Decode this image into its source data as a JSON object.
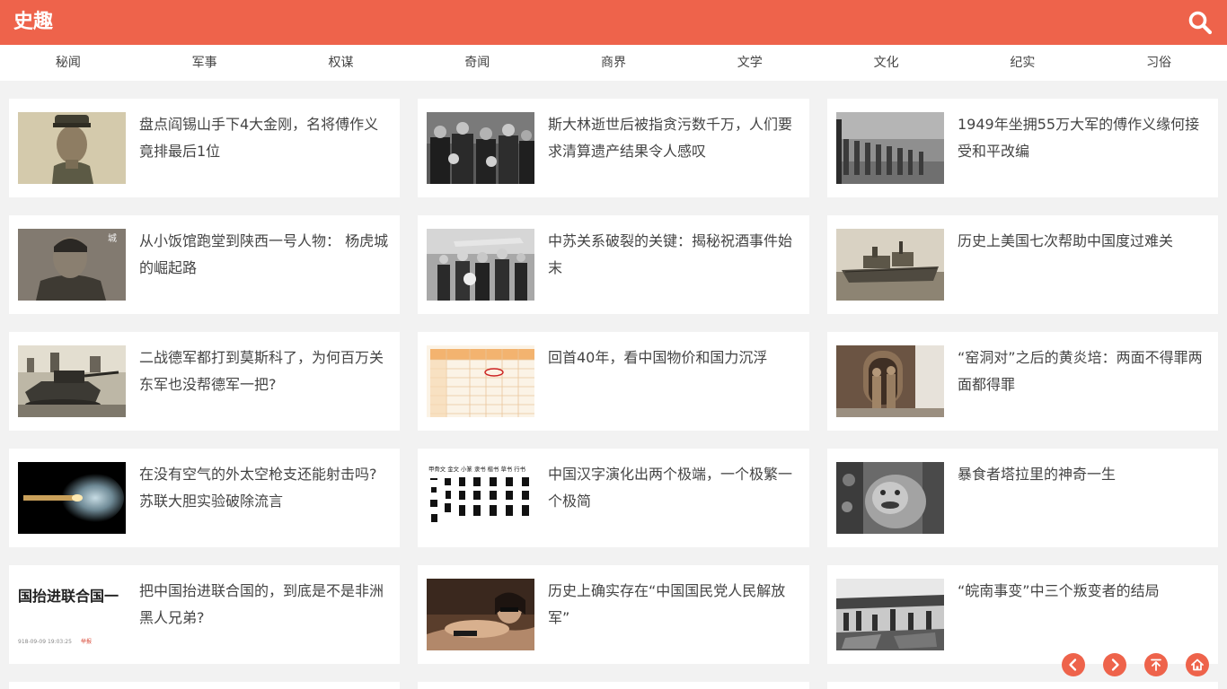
{
  "header": {
    "logo": "史趣",
    "search_icon": "search-icon",
    "bg_color": "#ee634b"
  },
  "nav": [
    {
      "label": "秘闻"
    },
    {
      "label": "军事"
    },
    {
      "label": "权谋"
    },
    {
      "label": "奇闻"
    },
    {
      "label": "商界"
    },
    {
      "label": "文学"
    },
    {
      "label": "文化"
    },
    {
      "label": "纪实"
    },
    {
      "label": "习俗"
    }
  ],
  "articles": [
    {
      "title": "盘点阎锡山手下4大金刚，名将傅作义竟排最后1位"
    },
    {
      "title": "斯大林逝世后被指贪污数千万，人们要求清算遗产结果令人感叹"
    },
    {
      "title": "1949年坐拥55万大军的傅作义缘何接受和平改编"
    },
    {
      "title": "从小饭馆跑堂到陕西一号人物： 杨虎城的崛起路"
    },
    {
      "title": "中苏关系破裂的关键：揭秘祝酒事件始末"
    },
    {
      "title": "历史上美国七次帮助中国度过难关"
    },
    {
      "title": "二战德军都打到莫斯科了，为何百万关东军也没帮德军一把?"
    },
    {
      "title": "回首40年，看中国物价和国力沉浮"
    },
    {
      "title": "“窑洞对”之后的黄炎培：两面不得罪两面都得罪"
    },
    {
      "title": "在没有空气的外太空枪支还能射击吗?苏联大胆实验破除流言"
    },
    {
      "title": "中国汉字演化出两个极端，一个极繁一个极简"
    },
    {
      "title": "暴食者塔拉里的神奇一生"
    },
    {
      "title": "把中国抬进联合国的，到底是不是非洲黑人兄弟?"
    },
    {
      "title": "历史上确实存在“中国国民党人民解放军”"
    },
    {
      "title": "“皖南事变”中三个叛变者的结局"
    }
  ],
  "thumb_texts": {
    "thumb_13_headline": "国抬进联合国一",
    "thumb_13_date": "918-09-09 19:03:25",
    "thumb_13_tag": "举报",
    "thumb_5_corner": "城",
    "thumb_11_header": "甲骨文 金文 小篆 隶书 楷书 草书 行书"
  },
  "fab": [
    {
      "icon": "chevron-left-icon"
    },
    {
      "icon": "chevron-right-icon"
    },
    {
      "icon": "back-to-top-icon"
    },
    {
      "icon": "home-icon"
    }
  ]
}
